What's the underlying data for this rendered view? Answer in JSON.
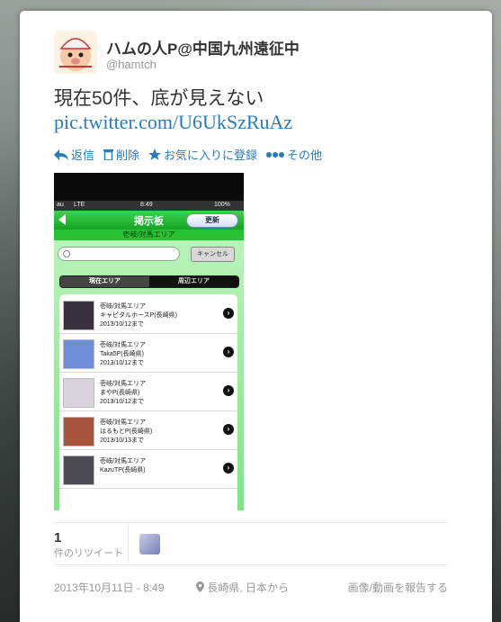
{
  "tweet": {
    "user_name": "ハムの人P@中国九州遠征中",
    "handle": "@hamtch",
    "text": "現在50件、底が見えない",
    "link": "pic.twitter.com/U6UkSzRuAz"
  },
  "actions": {
    "reply": "返信",
    "delete": "削除",
    "favorite": "お気に入りに登録",
    "more": "その他"
  },
  "screenshot": {
    "status": {
      "carrier": "au",
      "network": "LTE",
      "time": "8:49",
      "battery": "100%"
    },
    "nav_title": "掲示板",
    "refresh_label": "更新",
    "subtitle": "壱岐/対馬エリア",
    "cancel_label": "キャンセル",
    "segments": [
      "現在エリア",
      "周辺エリア"
    ],
    "rows": [
      {
        "area": "壱岐/対馬エリア",
        "name": "キャピタルホースP(長崎県)",
        "date": "2013/10/12まで",
        "avatar_color": "#3a3140"
      },
      {
        "area": "壱岐/対馬エリア",
        "name": "Taka5P(長崎県)",
        "date": "2013/10/12まで",
        "avatar_color": "#6e8fd8"
      },
      {
        "area": "壱岐/対馬エリア",
        "name": "まやP(長崎県)",
        "date": "2013/10/12まで",
        "avatar_color": "#d9d1dc"
      },
      {
        "area": "壱岐/対馬エリア",
        "name": "はるもとP(長崎県)",
        "date": "2013/10/13まで",
        "avatar_color": "#a7563e"
      },
      {
        "area": "壱岐/対馬エリア",
        "name": "KazuTP(長崎県)",
        "date": "",
        "avatar_color": "#4c4a52"
      }
    ]
  },
  "stats": {
    "retweet_count": "1",
    "retweet_label": "件のリツイート"
  },
  "footer": {
    "timestamp": "2013年10月11日 - 8:49",
    "location": "長崎県, 日本から",
    "report": "画像/動画を報告する"
  },
  "colors": {
    "link": "#2b7bb9",
    "app_green": "#27c134"
  }
}
